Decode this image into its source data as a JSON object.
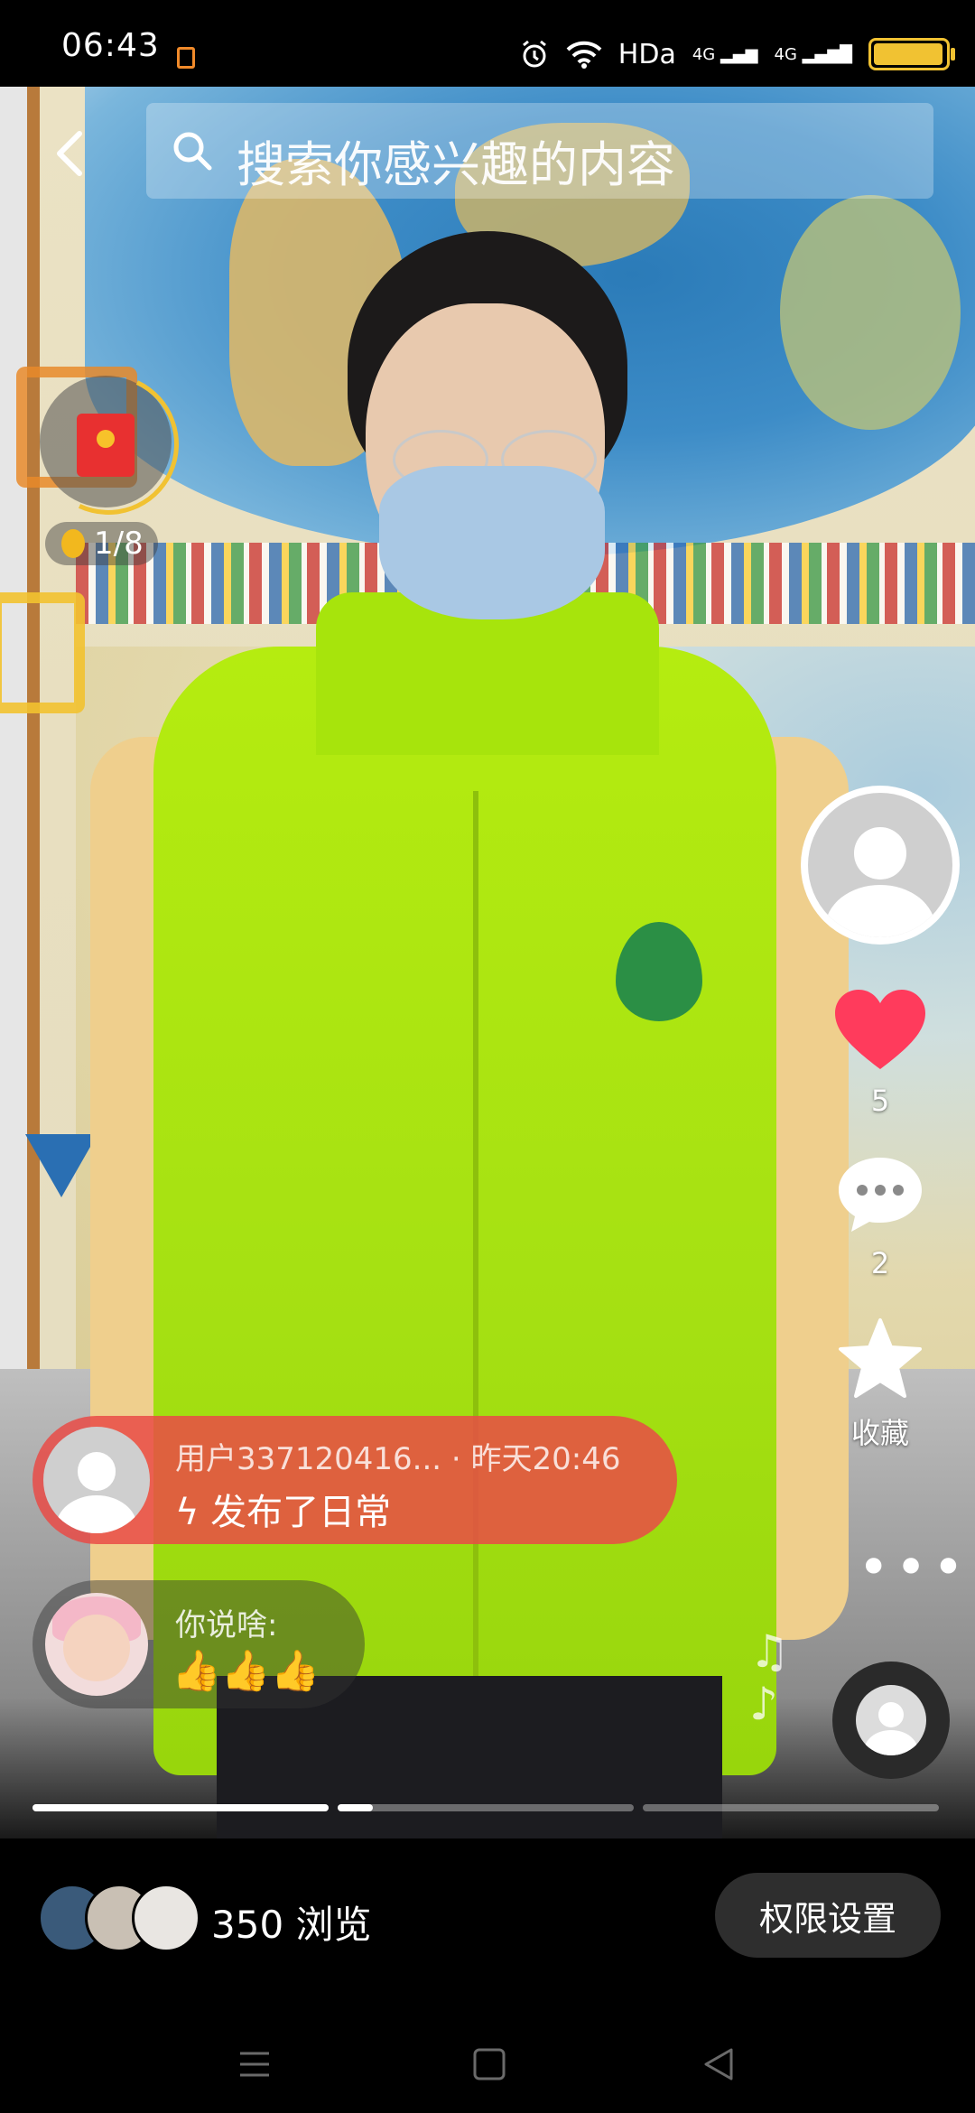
{
  "status_bar": {
    "time": "06:43",
    "network_label": "HDa",
    "signal_1": "4G",
    "signal_2": "4G",
    "battery_level": 0.9
  },
  "header": {
    "search_placeholder": "搜索你感兴趣的内容"
  },
  "red_packet": {
    "count": "1/8"
  },
  "side_actions": {
    "likes": "5",
    "comments": "2",
    "favorite_label": "收藏"
  },
  "post": {
    "meta": "用户337120416... · 昨天20:46",
    "action": "发布了日常"
  },
  "comment": {
    "question": "你说啥:",
    "emojis": "👍👍👍"
  },
  "progress": {
    "segments": [
      1.0,
      0.12,
      0.0
    ]
  },
  "bottom_bar": {
    "views_text": "350 浏览",
    "permission_button": "权限设置"
  },
  "colors": {
    "like": "#ff3b5c",
    "post_card": "#e94b46",
    "accent": "#f1c232"
  }
}
